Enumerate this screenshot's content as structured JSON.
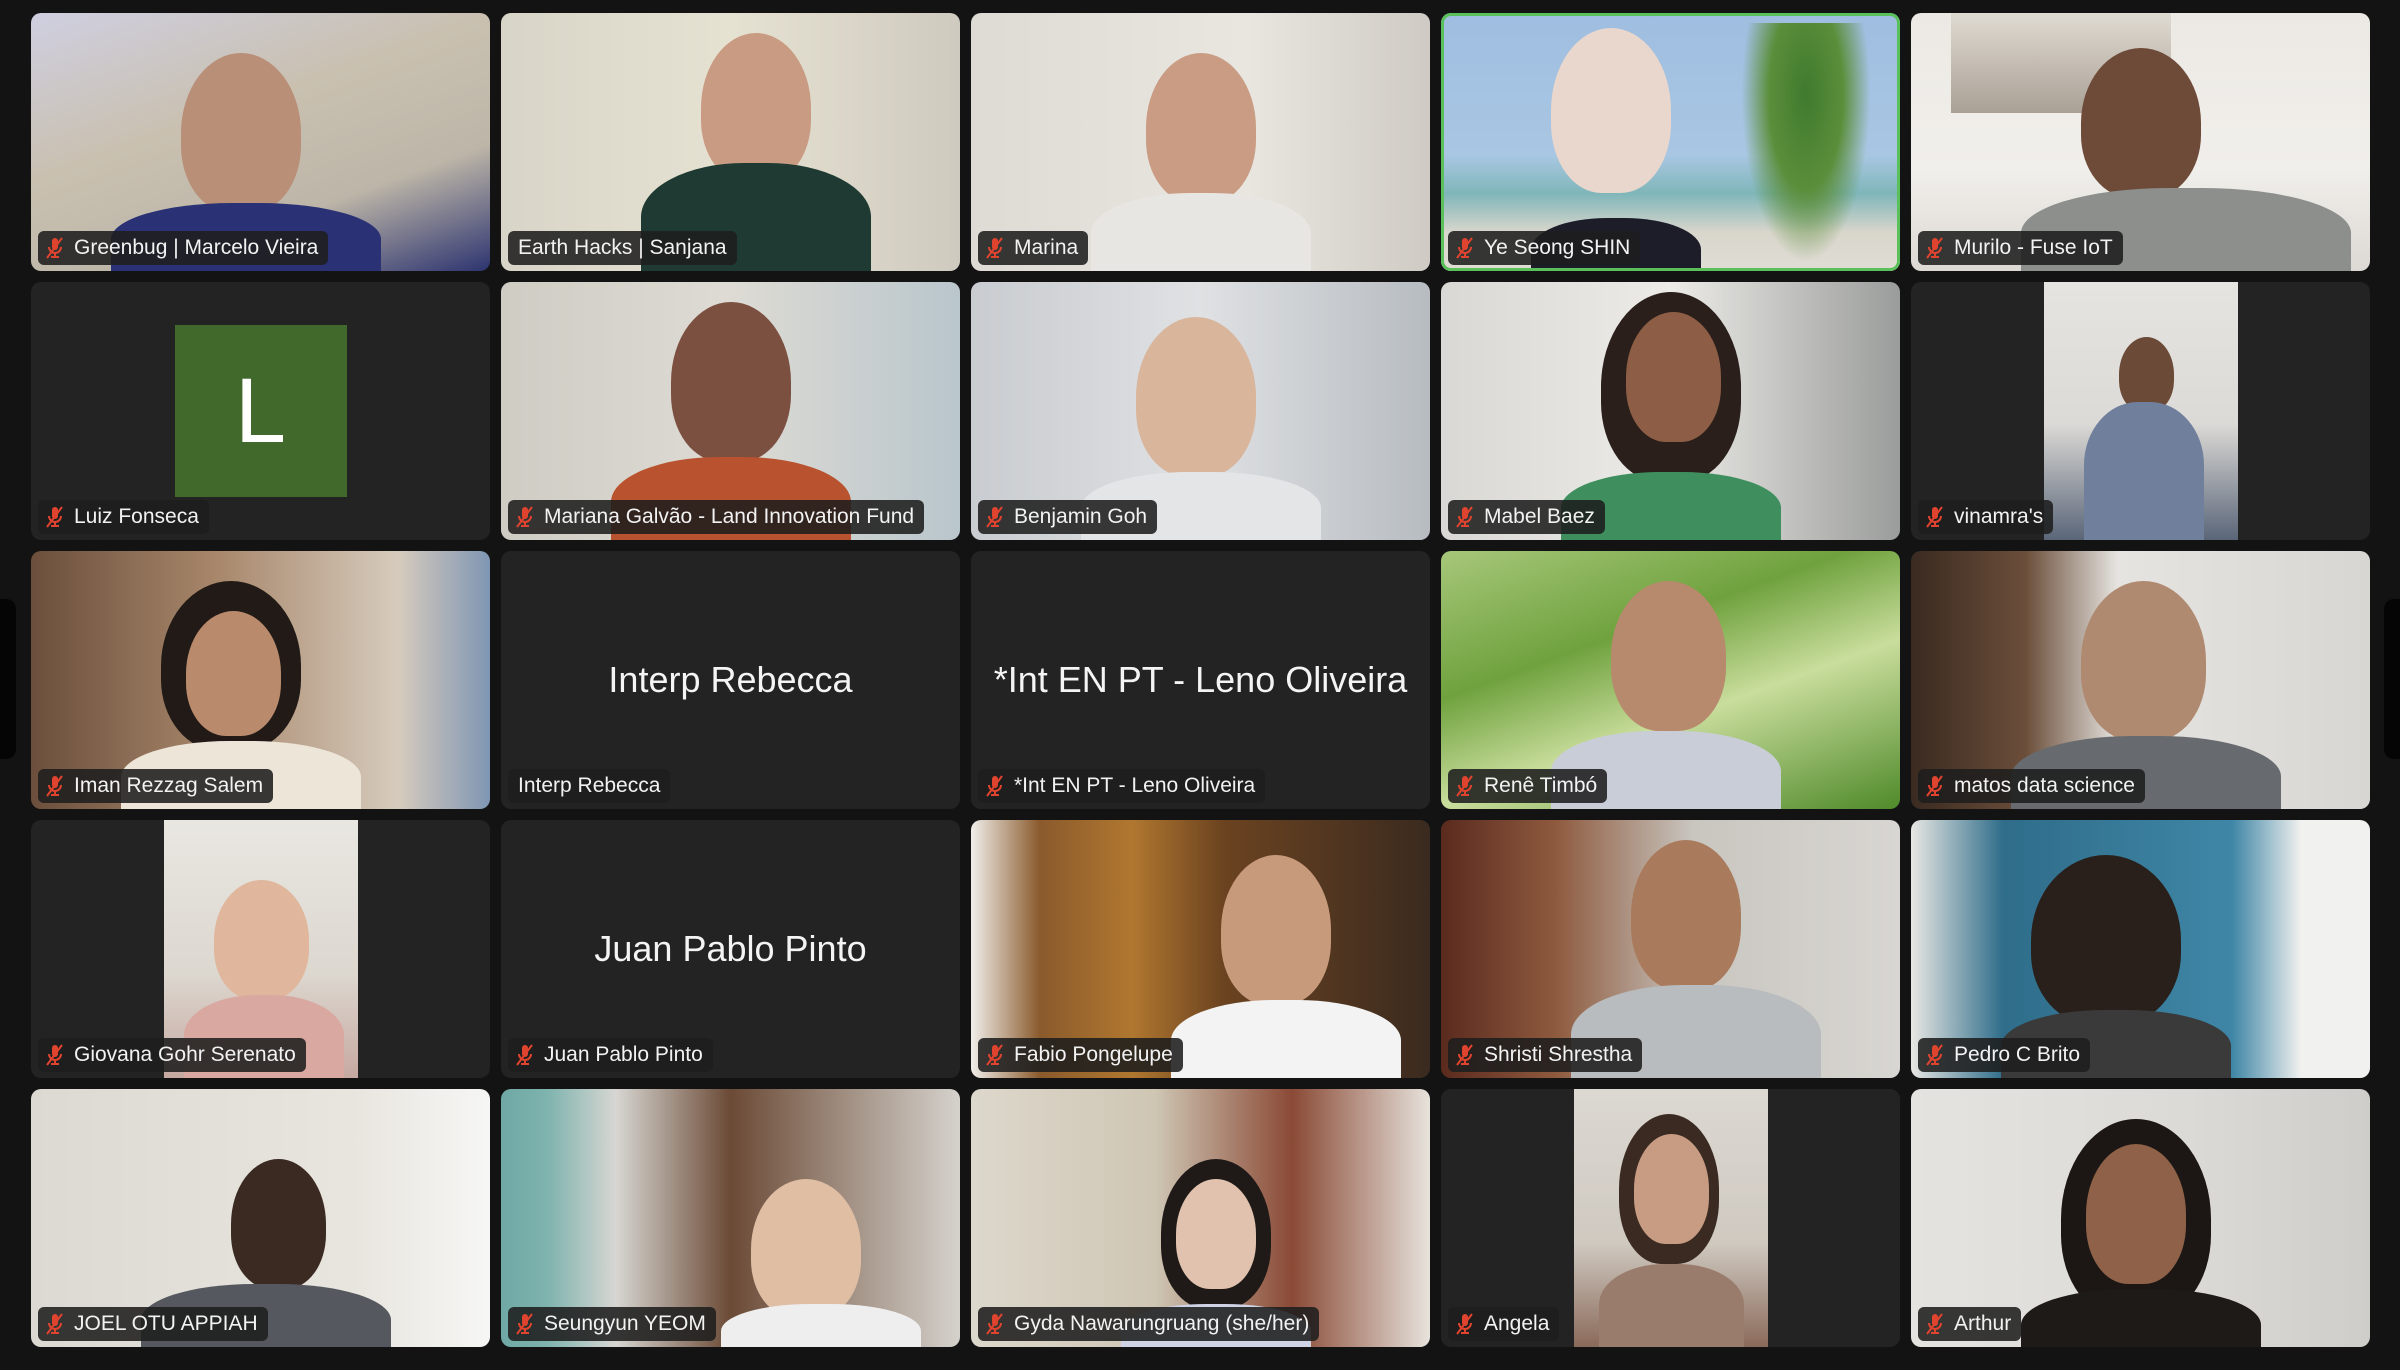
{
  "meeting": {
    "view": "gallery",
    "active_speaker_color": "#5ac05a",
    "muted_icon_color": "#e0442f",
    "avatar_color": "#41692b"
  },
  "participants": [
    {
      "name": "Greenbug | Marcelo Vieira",
      "muted": true,
      "video": true
    },
    {
      "name": "Earth Hacks | Sanjana",
      "muted": false,
      "video": true
    },
    {
      "name": "Marina",
      "muted": true,
      "video": true
    },
    {
      "name": "Ye Seong SHIN",
      "muted": true,
      "video": true,
      "active_speaker": true
    },
    {
      "name": "Murilo - Fuse IoT",
      "muted": true,
      "video": true
    },
    {
      "name": "Luiz Fonseca",
      "muted": true,
      "video": false,
      "avatar_letter": "L"
    },
    {
      "name": "Mariana Galvão - Land Innovation Fund",
      "muted": true,
      "video": true
    },
    {
      "name": "Benjamin Goh",
      "muted": true,
      "video": true
    },
    {
      "name": "Mabel Baez",
      "muted": true,
      "video": true
    },
    {
      "name": "vinamra's",
      "muted": true,
      "video": true
    },
    {
      "name": "Iman Rezzag Salem",
      "muted": true,
      "video": true
    },
    {
      "name": "Interp Rebecca",
      "muted": false,
      "video": false
    },
    {
      "name": "*Int EN PT - Leno Oliveira",
      "muted": true,
      "video": false
    },
    {
      "name": "Renê Timbó",
      "muted": true,
      "video": true
    },
    {
      "name": "matos data science",
      "muted": true,
      "video": true
    },
    {
      "name": "Giovana Gohr Serenato",
      "muted": true,
      "video": true
    },
    {
      "name": "Juan Pablo Pinto",
      "muted": true,
      "video": false
    },
    {
      "name": "Fabio Pongelupe",
      "muted": true,
      "video": true
    },
    {
      "name": "Shristi Shrestha",
      "muted": true,
      "video": true
    },
    {
      "name": "Pedro C Brito",
      "muted": true,
      "video": true
    },
    {
      "name": "JOEL OTU APPIAH",
      "muted": true,
      "video": true
    },
    {
      "name": "Seungyun YEOM",
      "muted": true,
      "video": true
    },
    {
      "name": "Gyda Nawarungruang (she/her)",
      "muted": true,
      "video": true
    },
    {
      "name": "Angela",
      "muted": true,
      "video": true
    },
    {
      "name": "Arthur",
      "muted": true,
      "video": true
    }
  ],
  "navigation": {
    "prev_page_icon": "page-left-tab",
    "next_page_icon": "page-right-tab"
  }
}
